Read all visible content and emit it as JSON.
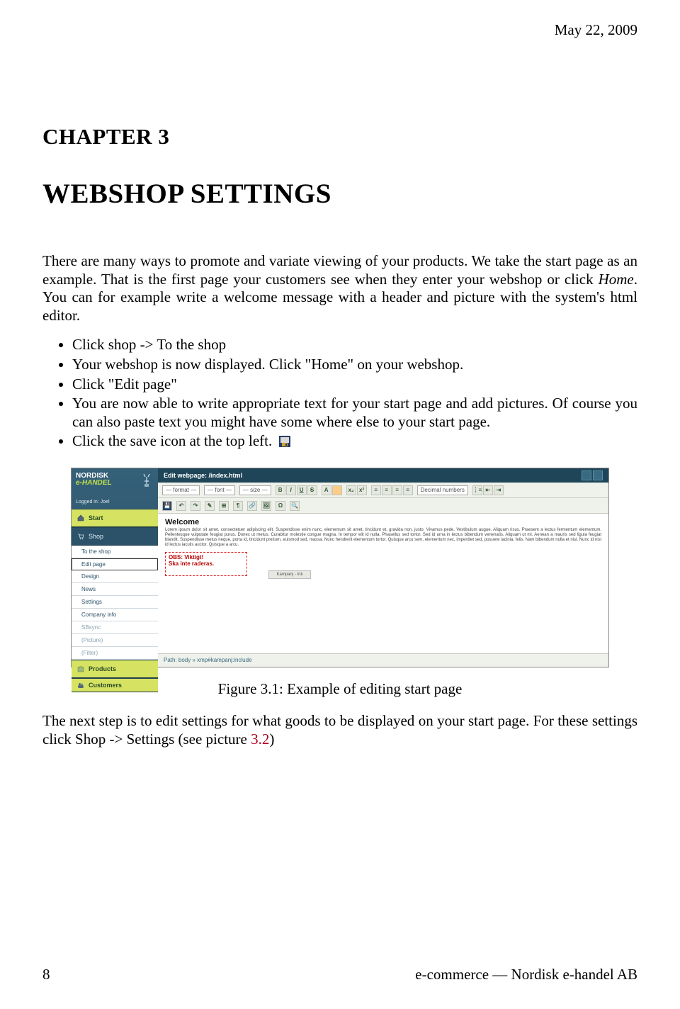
{
  "header": {
    "date": "May 22, 2009"
  },
  "chapter": {
    "label_prefix": "C",
    "label_rest": "HAPTER",
    "number": "3",
    "title_prefix": "W",
    "title_rest": "EBSHOP SETTINGS"
  },
  "paragraphs": {
    "p1a": "There are many ways to promote and variate viewing of your products. We take the start page as an example. That is the first page your customers see when they enter your webshop or click ",
    "p1_home": "Home",
    "p1b": ". You can for example write a welcome message with a header and picture with the system's html editor."
  },
  "list": {
    "i1": "Click shop -> To the shop",
    "i2": "Your webshop is now displayed. Click \"Home\" on your webshop.",
    "i3": "Click \"Edit page\"",
    "i4": "You are now able to write appropriate text for your start page and add pictures. Of course you can also paste text you might have some where else to your start page.",
    "i5": "Click the save icon at the top left."
  },
  "figure": {
    "titlebar": "Edit webpage: /index.html",
    "logo_line1": "NORDISK",
    "logo_line2": "e-HANDEL",
    "logged_label": "Logged in:",
    "logged_user": "Joel",
    "sidebar": {
      "start": "Start",
      "shop": "Shop",
      "subs": [
        "To the shop",
        "Edit page",
        "Design",
        "News",
        "Settings",
        "Company info",
        "SBsync",
        "(Picture)",
        "(Filter)"
      ],
      "products": "Products",
      "customers": "Customers"
    },
    "toolbar": {
      "format": "— format —",
      "font": "— font —",
      "size": "— size —",
      "numbers": "Decimal numbers"
    },
    "content": {
      "heading": "Welcome",
      "lorem": "Lorem ipsum dolor sit amet, consectetuer adipiscing elit. Suspendisse enim nunc, elementum sit amet, tincidunt et, gravida non, justo. Vivamus pede. Vestibulum augue. Aliquam risus. Praesent a lectus fermentum elementum. Pellentesque vulputate feugiat purus. Donec ut metus. Curabitur molestie congue magna. In tempor elit id nulla. Phasellus sed tortor. Sed id urna in lectus bibendum venenatis. Aliquam ut mi. Aenean a mauris sed ligula feugiat blandit. Suspendisse metus neque, porta id, tincidunt pretium, euismod sed, massa. Nunc hendrerit elementum tortor. Quisque arcu sem, elementum nec, imperdiet sed, posuere lacinia, felis. Nam bibendum nulla et nisl. Nunc id nisl id lectus iaculis auctor. Quisque a arcu.",
      "redbox_l1": "OBS: Viktigt!",
      "redbox_l2": "Ska inte raderas.",
      "drag": "Kampanj - Ink"
    },
    "footer_path": "Path:  body » xmp#kampanj:include"
  },
  "caption": {
    "label": "Figure 3.1: Example of editing start page"
  },
  "closing": {
    "text_a": "The next step is to edit settings for what goods to be displayed on your start page. For these settings click Shop -> Settings (see picture ",
    "ref": "3.2",
    "text_b": ")"
  },
  "footer": {
    "page": "8",
    "right": "e-commerce — Nordisk e-handel AB"
  }
}
